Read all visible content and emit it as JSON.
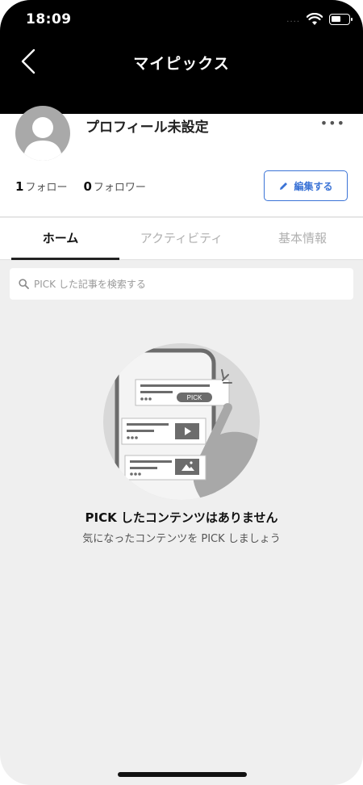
{
  "status": {
    "time": "18:09"
  },
  "nav": {
    "title": "マイピックス"
  },
  "profile": {
    "name": "プロフィール未設定",
    "following_count": "1",
    "following_label": "フォロー",
    "followers_count": "0",
    "followers_label": "フォロワー",
    "edit_label": "編集する"
  },
  "tabs": [
    {
      "label": "ホーム",
      "active": true
    },
    {
      "label": "アクティビティ",
      "active": false
    },
    {
      "label": "基本情報",
      "active": false
    }
  ],
  "search": {
    "placeholder": "PICK した記事を検索する"
  },
  "empty_state": {
    "title": "PICK したコンテンツはありません",
    "subtitle": "気になったコンテンツを PICK しましょう",
    "illustration_badge": "PICK"
  },
  "colors": {
    "accent": "#3b73d6",
    "header_bg": "#000000",
    "content_bg": "#efefef"
  }
}
